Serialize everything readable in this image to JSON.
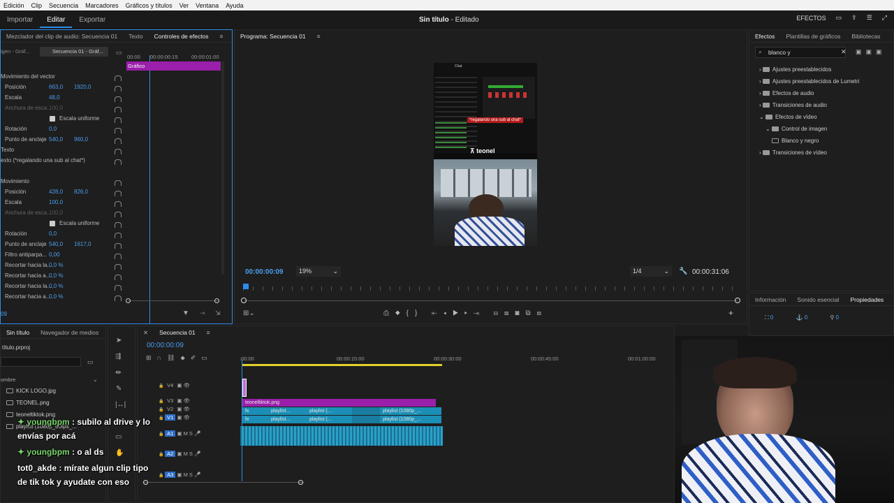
{
  "menu": [
    "Edición",
    "Clip",
    "Secuencia",
    "Marcadores",
    "Gráficos y títulos",
    "Ver",
    "Ventana",
    "Ayuda"
  ],
  "workspace": {
    "tabs": [
      "Importar",
      "Editar",
      "Exportar"
    ],
    "active": "Editar",
    "title": "Sin título",
    "status": "- Editado",
    "effects_label": "EFECTOS"
  },
  "source_panel": {
    "tabs": [
      "Mezclador del clip de audio: Secuencia 01",
      "Texto",
      "Controles de efectos"
    ],
    "active_tab": "Controles de efectos",
    "master": "igen - Gráf...",
    "clip": "Secuencia 01 - Gráf...",
    "ruler": [
      "00:00",
      "00:00:00:15",
      "00:00:01:00"
    ],
    "graphic_label": "Gráfico",
    "rows": [
      {
        "label": "Movimiento del vector",
        "vals": []
      },
      {
        "label": "Posición",
        "vals": [
          "663,0",
          "1920,0"
        ]
      },
      {
        "label": "Escala",
        "vals": [
          "48,0"
        ]
      },
      {
        "label": "Anchura de esca...",
        "vals": [
          "100,0"
        ],
        "dim": true
      },
      {
        "label": "Escala uniforme",
        "vals": [],
        "check": true
      },
      {
        "label": "Rotación",
        "vals": [
          "0,0"
        ]
      },
      {
        "label": "Punto de anclaje",
        "vals": [
          "540,0",
          "960,0"
        ]
      },
      {
        "label": "Texto",
        "vals": []
      },
      {
        "label": "exto (*regalando una sub al chat*)",
        "vals": []
      },
      {
        "label": "",
        "vals": []
      },
      {
        "label": "Movimiento",
        "vals": []
      },
      {
        "label": "Posición",
        "vals": [
          "428,0",
          "826,0"
        ]
      },
      {
        "label": "Escala",
        "vals": [
          "100,0"
        ]
      },
      {
        "label": "Anchura de esca...",
        "vals": [
          "100,0"
        ],
        "dim": true
      },
      {
        "label": "Escala uniforme",
        "vals": [],
        "check": true
      },
      {
        "label": "Rotación",
        "vals": [
          "0,0"
        ]
      },
      {
        "label": "Punto de anclaje",
        "vals": [
          "540,0",
          "1617,0"
        ]
      },
      {
        "label": "Filtro antiparpa...",
        "vals": [
          "0,00"
        ]
      },
      {
        "label": "Recortar hacia la...",
        "vals": [
          "0,0 %"
        ]
      },
      {
        "label": "Recortar hacia a...",
        "vals": [
          "0,0 %"
        ]
      },
      {
        "label": "Recortar hacia la...",
        "vals": [
          "0,0 %"
        ]
      },
      {
        "label": "Recortar hacia a...",
        "vals": [
          "0,0 %"
        ]
      }
    ],
    "bottom_time": "09"
  },
  "program": {
    "title": "Programa: Secuencia 01",
    "timecode": "00:00:00:09",
    "zoom": "19%",
    "quality": "1/4",
    "duration": "00:00:31:06",
    "overlay_text": "*regalando una sub al chat*",
    "brand": "teonel"
  },
  "effects_panel": {
    "tabs": [
      "Efectos",
      "Plantillas de gráficos",
      "Bibliotecas"
    ],
    "search": "blanco y",
    "tree": [
      {
        "label": "Ajustes preestablecidos",
        "level": 0,
        "open": false
      },
      {
        "label": "Ajustes preestablecidos de Lumetri",
        "level": 0,
        "open": false
      },
      {
        "label": "Efectos de audio",
        "level": 0,
        "open": false
      },
      {
        "label": "Transiciones de audio",
        "level": 0,
        "open": false
      },
      {
        "label": "Efectos de vídeo",
        "level": 0,
        "open": true
      },
      {
        "label": "Control de imagen",
        "level": 1,
        "open": true
      },
      {
        "label": "Blanco y negro",
        "level": 2,
        "selected": true
      },
      {
        "label": "Transiciones de vídeo",
        "level": 0,
        "open": false
      }
    ]
  },
  "info_panel": {
    "tabs": [
      "Información",
      "Sonido esencial",
      "Propiedades"
    ],
    "vals": [
      "0",
      "0",
      "0"
    ]
  },
  "project_panel": {
    "tabs": [
      "Sin título",
      "Navegador de medios"
    ],
    "project": "título.prproj",
    "col": "ombre",
    "items": [
      "KICK LOGO.jpg",
      "TEONEL.png",
      "teoneltiktok.png",
      "playlist (1080p_60fps_..."
    ]
  },
  "timeline": {
    "tab": "Secuencia 01",
    "timecode": "00:00:00:09",
    "ruler": [
      ":00:00",
      "00:00:15:00",
      "00:00:30:00",
      "00:00:45:00",
      "00:01:00:00"
    ],
    "tracks": [
      "V4",
      "V3",
      "V2",
      "V1",
      "A1",
      "A2",
      "A3"
    ],
    "clips": {
      "v3": "teoneltiktok.png",
      "v2": [
        "playlist...",
        "playlist (...",
        "playlist (1080p_..."
      ],
      "v1": [
        "playlist...",
        "playlist (...",
        "playlist (1080p_..."
      ]
    }
  },
  "chat": [
    {
      "user": "youngbpm",
      "text": ": subilo al drive y lo",
      "cont": "envías por acá"
    },
    {
      "user": "youngbpm",
      "text": ": o al ds"
    },
    {
      "user": "tot0_akde",
      "text": ": mírate algun clip tipo",
      "cont": "de tik tok y ayudate con eso"
    }
  ],
  "colors": {
    "accent": "#2d8ceb",
    "graphic": "#9a1faa",
    "video": "#1b8fb5",
    "audio": "#2aa0c8",
    "user": "#7ad66c"
  }
}
